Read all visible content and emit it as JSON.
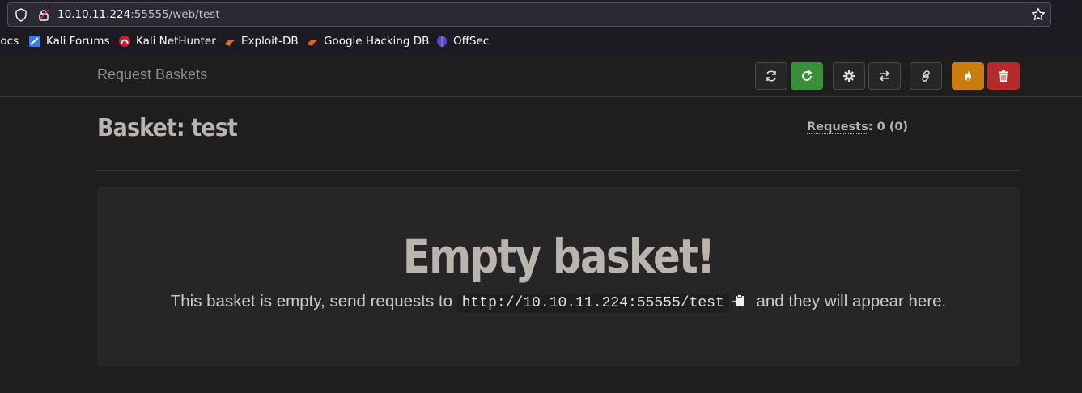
{
  "browser": {
    "url_host": "10.10.11.224",
    "url_rest": ":55555/web/test",
    "bookmarks": [
      {
        "label": "Docs",
        "icon": "docs-icon"
      },
      {
        "label": "Kali Forums",
        "icon": "kali-forums-icon"
      },
      {
        "label": "Kali NetHunter",
        "icon": "nethunter-icon"
      },
      {
        "label": "Exploit-DB",
        "icon": "exploit-db-icon"
      },
      {
        "label": "Google Hacking DB",
        "icon": "ghdb-icon"
      },
      {
        "label": "OffSec",
        "icon": "offsec-icon"
      }
    ]
  },
  "navbar": {
    "brand": "Request Baskets",
    "buttons": [
      "refresh-button",
      "auto-refresh-button",
      "settings-button",
      "responses-button",
      "share-link-button",
      "destroy-button",
      "delete-button"
    ]
  },
  "basket": {
    "title": "Basket: test",
    "requests_label": "Requests",
    "requests_value": ": 0 (0)"
  },
  "empty": {
    "title": "Empty basket!",
    "msg_before": "This basket is empty, send requests to ",
    "url": "http://10.10.11.224:55555/test",
    "msg_after": " and they will appear here."
  },
  "colors": {
    "green": "#3a8f3a",
    "orange": "#c87d0e",
    "red": "#b52b2b"
  }
}
